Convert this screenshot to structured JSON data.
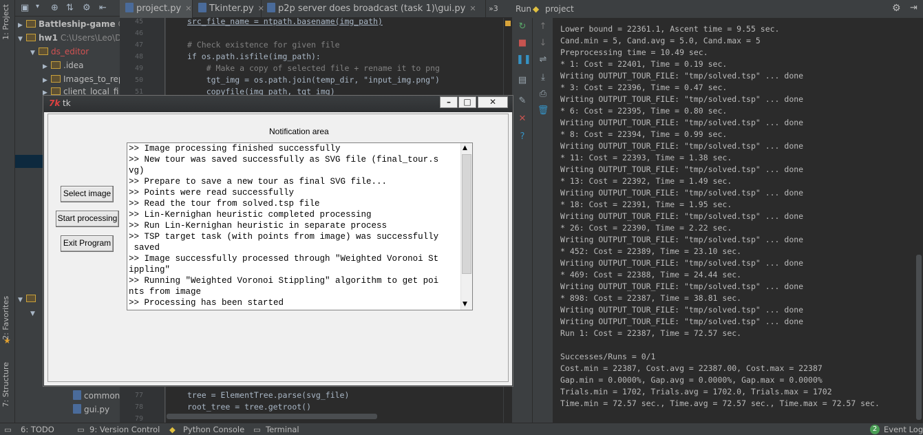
{
  "left_strip": {
    "tabs": [
      "1: Project",
      "2: Favorites",
      "7: Structure"
    ]
  },
  "project_tree": [
    {
      "label": "Battleship-game",
      "extra": "C:",
      "bold": true
    },
    {
      "label": "hw1",
      "extra": "C:\\Users\\Leo\\D",
      "bold": true
    },
    {
      "label": "ds_editor",
      "extra": "",
      "bold": false,
      "accent": true
    },
    {
      "label": ".idea",
      "extra": "",
      "bold": false
    },
    {
      "label": "Images_to_rep",
      "extra": "",
      "bold": false
    },
    {
      "label": "client_local_fi",
      "extra": "",
      "bold": false
    },
    {
      "label": "common.",
      "extra": "",
      "bold": false
    },
    {
      "label": "gui.py",
      "extra": "",
      "bold": false
    }
  ],
  "editor_tabs": [
    {
      "label": "project.py",
      "active": true
    },
    {
      "label": "Tkinter.py",
      "active": false
    },
    {
      "label": "p2p server does broadcast (task 1)\\gui.py",
      "active": false
    }
  ],
  "editor_tab_overflow": "»3",
  "code_lines": [
    {
      "num": "45",
      "text": "src_file_name = ntpath.basename(img_path)"
    },
    {
      "num": "46",
      "text": ""
    },
    {
      "num": "47",
      "text": "# Check existence for given file"
    },
    {
      "num": "48",
      "text": "if os.path.isfile(img_path):"
    },
    {
      "num": "49",
      "text": "    # Make a copy of selected file + rename it to png"
    },
    {
      "num": "50",
      "text": "    tgt_img = os.path.join(temp_dir, \"input_img.png\")"
    },
    {
      "num": "51",
      "text": "    copyfile(img_path, tgt_img)"
    }
  ],
  "code_lines_bottom": [
    {
      "num": "77",
      "text": "tree = ElementTree.parse(svg_file)"
    },
    {
      "num": "78",
      "text": "root_tree = tree.getroot()"
    },
    {
      "num": "79",
      "text": ""
    }
  ],
  "run_panel": {
    "label": "Run",
    "config": "project"
  },
  "console_lines": [
    "Lower bound = 22361.1, Ascent time = 9.55 sec.",
    "Cand.min = 5, Cand.avg = 5.0, Cand.max = 5",
    "Preprocessing time = 10.49 sec.",
    "* 1: Cost = 22401, Time = 0.19 sec.",
    "Writing OUTPUT_TOUR_FILE: \"tmp/solved.tsp\" ... done",
    "* 3: Cost = 22396, Time = 0.47 sec.",
    "Writing OUTPUT_TOUR_FILE: \"tmp/solved.tsp\" ... done",
    "* 6: Cost = 22395, Time = 0.80 sec.",
    "Writing OUTPUT_TOUR_FILE: \"tmp/solved.tsp\" ... done",
    "* 8: Cost = 22394, Time = 0.99 sec.",
    "Writing OUTPUT_TOUR_FILE: \"tmp/solved.tsp\" ... done",
    "* 11: Cost = 22393, Time = 1.38 sec.",
    "Writing OUTPUT_TOUR_FILE: \"tmp/solved.tsp\" ... done",
    "* 13: Cost = 22392, Time = 1.49 sec.",
    "Writing OUTPUT_TOUR_FILE: \"tmp/solved.tsp\" ... done",
    "* 18: Cost = 22391, Time = 1.95 sec.",
    "Writing OUTPUT_TOUR_FILE: \"tmp/solved.tsp\" ... done",
    "* 26: Cost = 22390, Time = 2.22 sec.",
    "Writing OUTPUT_TOUR_FILE: \"tmp/solved.tsp\" ... done",
    "* 452: Cost = 22389, Time = 23.10 sec.",
    "Writing OUTPUT_TOUR_FILE: \"tmp/solved.tsp\" ... done",
    "* 469: Cost = 22388, Time = 24.44 sec.",
    "Writing OUTPUT_TOUR_FILE: \"tmp/solved.tsp\" ... done",
    "* 898: Cost = 22387, Time = 38.81 sec.",
    "Writing OUTPUT_TOUR_FILE: \"tmp/solved.tsp\" ... done",
    "Writing OUTPUT_TOUR_FILE: \"tmp/solved.tsp\" ... done",
    "Run 1: Cost = 22387, Time = 72.57 sec.",
    "",
    "Successes/Runs = 0/1",
    "Cost.min = 22387, Cost.avg = 22387.00, Cost.max = 22387",
    "Gap.min = 0.0000%, Gap.avg = 0.0000%, Gap.max = 0.0000%",
    "Trials.min = 1702, Trials.avg = 1702.0, Trials.max = 1702",
    "Time.min = 72.57 sec., Time.avg = 72.57 sec., Time.max = 72.57 sec."
  ],
  "status_bar": {
    "todo": "6: TODO",
    "vcs": "9: Version Control",
    "python_console": "Python Console",
    "terminal": "Terminal",
    "event_log": "Event Log",
    "event_count": "2"
  },
  "tk_window": {
    "title": "tk",
    "notification_label": "Notification area",
    "buttons": [
      "Select image",
      "Start processing",
      "Exit Program"
    ],
    "log_lines": [
      ">> Image processing finished successfully",
      ">> New tour was saved successfully as SVG file (final_tour.s",
      "vg)",
      ">> Prepare to save a new tour as final SVG file...",
      ">> Points were read successfully",
      ">> Read the tour from solved.tsp file",
      ">> Lin-Kernighan heuristic completed processing",
      ">> Run Lin-Kernighan heuristic in separate process",
      ">> TSP target task (with points from image) was successfully",
      " saved",
      ">> Image successfully processed through \"Weighted Voronoi St",
      "ippling\"",
      ">> Running \"Weighted Voronoi Stippling\" algorithm to get poi",
      "nts from image",
      ">> Processing has been started"
    ]
  },
  "colors": {
    "ide_bg": "#3c3f41",
    "editor_bg": "#2b2b2b",
    "comment": "#808080",
    "keyword": "#cc7832",
    "string": "#6a8759",
    "tk_bg": "#f0f0f0"
  }
}
